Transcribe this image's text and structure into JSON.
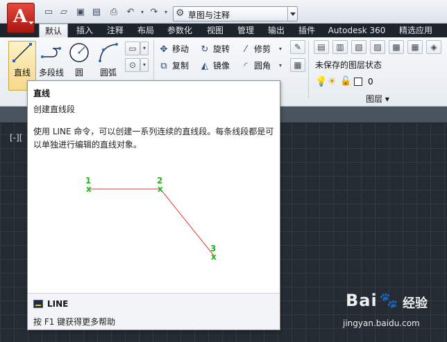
{
  "title_bar": {
    "app_letter": "A",
    "workspace": "草图与注释",
    "qat_icons": [
      "new-icon",
      "open-icon",
      "save-icon",
      "save-as-icon",
      "print-icon",
      "undo-icon",
      "redo-icon"
    ]
  },
  "tabs": [
    {
      "label": "默认",
      "active": true
    },
    {
      "label": "插入"
    },
    {
      "label": "注释"
    },
    {
      "label": "布局"
    },
    {
      "label": "参数化"
    },
    {
      "label": "视图"
    },
    {
      "label": "管理"
    },
    {
      "label": "输出"
    },
    {
      "label": "插件"
    },
    {
      "label": "Autodesk 360"
    },
    {
      "label": "精选应用"
    }
  ],
  "ribbon": {
    "draw_buttons": [
      {
        "label": "直线",
        "icon": "line-icon",
        "active": true
      },
      {
        "label": "多段线",
        "icon": "polyline-icon"
      },
      {
        "label": "圆",
        "icon": "circle-icon"
      },
      {
        "label": "圆弧",
        "icon": "arc-icon"
      }
    ],
    "modify_tools": [
      {
        "label": "移动",
        "icon": "move-icon"
      },
      {
        "label": "旋转",
        "icon": "rotate-icon"
      },
      {
        "label": "修剪",
        "icon": "trim-icon"
      },
      {
        "label": "复制",
        "icon": "copy-icon"
      },
      {
        "label": "镜像",
        "icon": "mirror-icon"
      },
      {
        "label": "圆角",
        "icon": "fillet-icon"
      }
    ],
    "layer_state": "未保存的图层状态",
    "current_layer": "0",
    "layers_panel_title": "图层 ▾"
  },
  "viewport_label": "[-][",
  "tooltip": {
    "title": "直线",
    "subtitle": "创建直线段",
    "description": "使用 LINE 命令，可以创建一系列连续的直线段。每条线段都是可以单独进行编辑的直线对象。",
    "points": [
      {
        "label": "1",
        "marker": "x"
      },
      {
        "label": "2",
        "marker": "x"
      },
      {
        "label": "3",
        "marker": "x"
      }
    ],
    "command": "LINE",
    "help_text": "按 F1 键获得更多帮助",
    "colors": {
      "point": "#22b422",
      "segment": "#e23a3a"
    }
  },
  "watermark": {
    "brand": "Bai",
    "suffix": "经验",
    "url": "jingyan.baidu.com"
  }
}
